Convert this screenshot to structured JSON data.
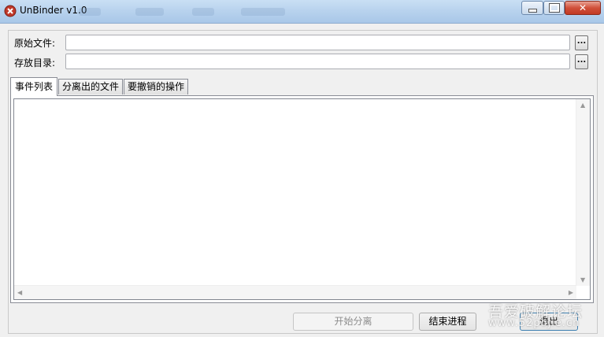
{
  "window": {
    "title": "UnBinder v1.0",
    "controls": {
      "minimize": "minimize",
      "maximize": "maximize",
      "close": "✕"
    }
  },
  "form": {
    "source_label": "原始文件:",
    "source_value": "",
    "dest_label": "存放目录:",
    "dest_value": "",
    "browse_label": "..."
  },
  "tabs": [
    {
      "label": "事件列表",
      "active": true
    },
    {
      "label": "分离出的文件",
      "active": false
    },
    {
      "label": "要撤销的操作",
      "active": false
    }
  ],
  "buttons": {
    "start": "开始分离",
    "end": "结束进程",
    "exit": "退出"
  },
  "watermark": {
    "line1": "吾爱破解论坛",
    "line2": "www.52pojie.cn"
  },
  "colors": {
    "titlebar": "#b9d3ee",
    "close_button": "#c94a35",
    "window_bg": "#f0f0f0"
  }
}
